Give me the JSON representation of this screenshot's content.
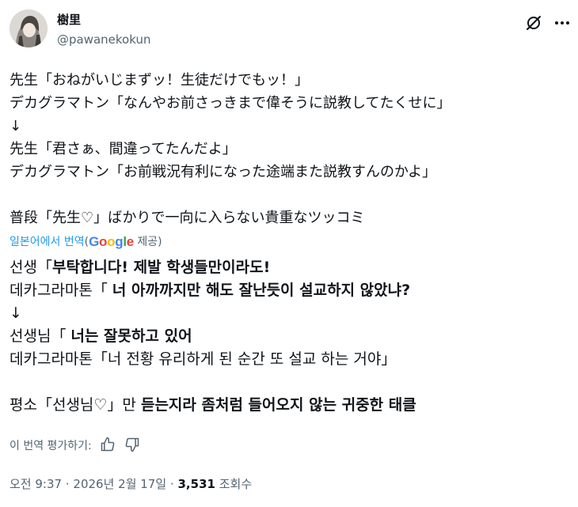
{
  "author": {
    "name": "樹里",
    "handle": "@pawanekokun"
  },
  "original_lines": [
    "先生「おねがいじまずッ！生徒だけでもッ！」",
    "デカグラマトン「なんやお前さっきまで偉そうに説教してたくせに」",
    "↓",
    "先生「君さぁ、間違ってたんだよ」",
    "デカグラマトン「お前戦況有利になった途端また説教すんのかよ」",
    "",
    "普段「先生♡」ばかりで一向に入らない貴重なツッコミ"
  ],
  "translation_bar": {
    "prefix": "일본어에서 번역",
    "paren_open": "(",
    "brand": "Google",
    "suffix": "제공)"
  },
  "translated": {
    "l1_a": "선생「",
    "l1_b": "부탁합니다! 제발 학생들만이라도!",
    "l2_a": "데카그라마톤「 ",
    "l2_b": "너 아까까지만 해도 잘난듯이 설교하지 않았냐?",
    "l3": "↓",
    "l4_a": "선생님「 ",
    "l4_b": "너는 잘못하고 있어",
    "l5": "데카그라마톤「너 전황 유리하게 된 순간 또 설교 하는 거야」",
    "l7_a": "평소「선생님♡」만 ",
    "l7_b": "듣는지라 좀처럼 들어오지 않는 귀중한 태클"
  },
  "rate_translation_label": "이 번역 평가하기:",
  "meta": {
    "time": "오전 9:37",
    "sep1": "·",
    "date": "2026년 2월 17일",
    "sep2": "·",
    "views_count": "3,531",
    "views_label": "조회수"
  },
  "icons": [
    "avatar",
    "grok-icon",
    "more-icon",
    "thumbs-up-icon",
    "thumbs-down-icon"
  ],
  "colors": {
    "text": "#0f1419",
    "secondary": "#536471",
    "link": "#1d9bf0"
  }
}
